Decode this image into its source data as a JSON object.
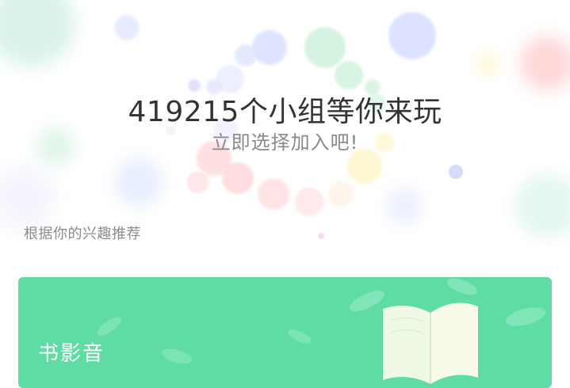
{
  "hero": {
    "headline": "419215个小组等你来玩",
    "subline": "立即选择加入吧!"
  },
  "recommend": {
    "label": "根据你的兴趣推荐"
  },
  "categories": [
    {
      "title": "书影音",
      "icon": "open-book-icon",
      "color": "#5fdca4"
    }
  ],
  "colors": {
    "card_green": "#5fdca4",
    "headline_text": "#333333",
    "subline_text": "#8a8a8a"
  }
}
